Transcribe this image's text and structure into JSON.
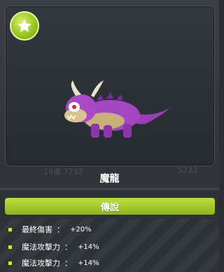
{
  "monster": {
    "name": "魔龍",
    "faint_left": "19進 7732",
    "faint_right": "5233"
  },
  "rank": {
    "label": "傳說",
    "color": "#a6cd2b"
  },
  "stats": [
    {
      "name": "最終傷害",
      "sep": "：",
      "value": "+20%"
    },
    {
      "name": "魔法攻擊力",
      "sep": "：",
      "value": "+14%"
    },
    {
      "name": "魔法攻擊力",
      "sep": "：",
      "value": "+14%"
    }
  ],
  "icons": {
    "badge": "star-icon",
    "bullet": "square-bullet-icon"
  }
}
